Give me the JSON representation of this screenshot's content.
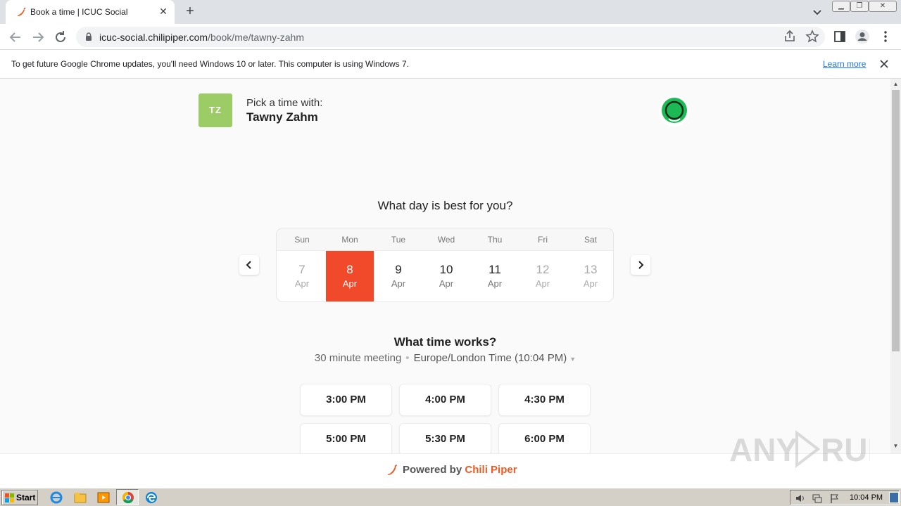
{
  "browser": {
    "tab_title": "Book a time | ICUC Social",
    "url_host": "icuc-social.chilipiper.com",
    "url_path": "/book/me/tawny-zahm"
  },
  "infobar": {
    "message": "To get future Google Chrome updates, you'll need Windows 10 or later. This computer is using Windows 7.",
    "link": "Learn more"
  },
  "host": {
    "initials": "TZ",
    "label": "Pick a time with:",
    "name": "Tawny Zahm"
  },
  "calendar": {
    "heading": "What day is best for you?",
    "weekdays": [
      "Sun",
      "Mon",
      "Tue",
      "Wed",
      "Thu",
      "Fri",
      "Sat"
    ],
    "days": [
      {
        "num": "7",
        "month": "Apr",
        "state": "disabled"
      },
      {
        "num": "8",
        "month": "Apr",
        "state": "selected"
      },
      {
        "num": "9",
        "month": "Apr",
        "state": "available"
      },
      {
        "num": "10",
        "month": "Apr",
        "state": "available"
      },
      {
        "num": "11",
        "month": "Apr",
        "state": "available"
      },
      {
        "num": "12",
        "month": "Apr",
        "state": "disabled"
      },
      {
        "num": "13",
        "month": "Apr",
        "state": "disabled"
      }
    ],
    "accent": "#f04a2b"
  },
  "times": {
    "heading": "What time works?",
    "duration": "30 minute meeting",
    "separator": "•",
    "timezone": "Europe/London Time (10:04 PM)",
    "slots": [
      "3:00 PM",
      "4:00 PM",
      "4:30 PM",
      "5:00 PM",
      "5:30 PM",
      "6:00 PM"
    ]
  },
  "footer": {
    "powered": "Powered by",
    "brand": "Chili Piper",
    "brand_color": "#f05a22"
  },
  "taskbar": {
    "start": "Start",
    "clock": "10:04 PM"
  }
}
